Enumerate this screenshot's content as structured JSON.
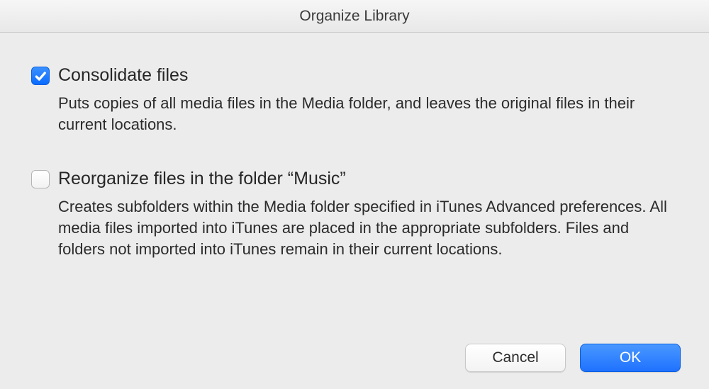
{
  "title": "Organize Library",
  "options": [
    {
      "label": "Consolidate files",
      "checked": true,
      "description": "Puts copies of all media files in the Media folder, and leaves the original files in their current locations."
    },
    {
      "label": "Reorganize files in the folder “Music”",
      "checked": false,
      "description": "Creates subfolders within the Media folder specified in iTunes Advanced preferences. All media files imported into iTunes are placed in the appropriate subfolders. Files and folders not imported into iTunes remain in their current locations."
    }
  ],
  "buttons": {
    "cancel": "Cancel",
    "ok": "OK"
  }
}
